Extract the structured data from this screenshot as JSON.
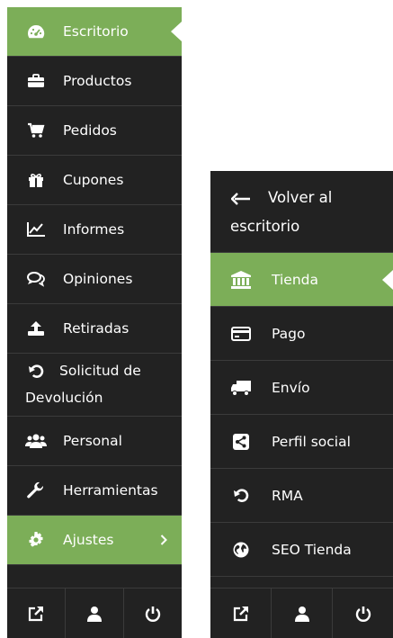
{
  "left_menu": {
    "items": [
      {
        "label": "Escritorio",
        "icon": "dashboard-icon"
      },
      {
        "label": "Productos",
        "icon": "briefcase-icon"
      },
      {
        "label": "Pedidos",
        "icon": "shopping-cart-icon"
      },
      {
        "label": "Cupones",
        "icon": "gift-icon"
      },
      {
        "label": "Informes",
        "icon": "line-chart-icon"
      },
      {
        "label": "Opiniones",
        "icon": "comments-icon"
      },
      {
        "label": "Retiradas",
        "icon": "upload-icon"
      },
      {
        "label": "Solicitud de Devolución",
        "icon": "undo-icon"
      },
      {
        "label": "Personal",
        "icon": "users-icon"
      },
      {
        "label": "Herramientas",
        "icon": "wrench-icon"
      },
      {
        "label": "Ajustes",
        "icon": "cog-icon"
      }
    ],
    "footer": [
      "external-link-icon",
      "user-icon",
      "power-icon"
    ]
  },
  "right_menu": {
    "items": [
      {
        "label": "Volver al escritorio",
        "icon": "arrow-left-icon"
      },
      {
        "label": "Tienda",
        "icon": "bank-icon"
      },
      {
        "label": "Pago",
        "icon": "credit-card-icon"
      },
      {
        "label": "Envío",
        "icon": "truck-icon"
      },
      {
        "label": "Perfil social",
        "icon": "share-icon"
      },
      {
        "label": "RMA",
        "icon": "undo-icon"
      },
      {
        "label": "SEO Tienda",
        "icon": "globe-icon"
      }
    ],
    "footer": [
      "external-link-icon",
      "user-icon",
      "power-icon"
    ]
  },
  "colors": {
    "panel": "#222222",
    "active": "#7cae58",
    "text": "#ffffff"
  }
}
